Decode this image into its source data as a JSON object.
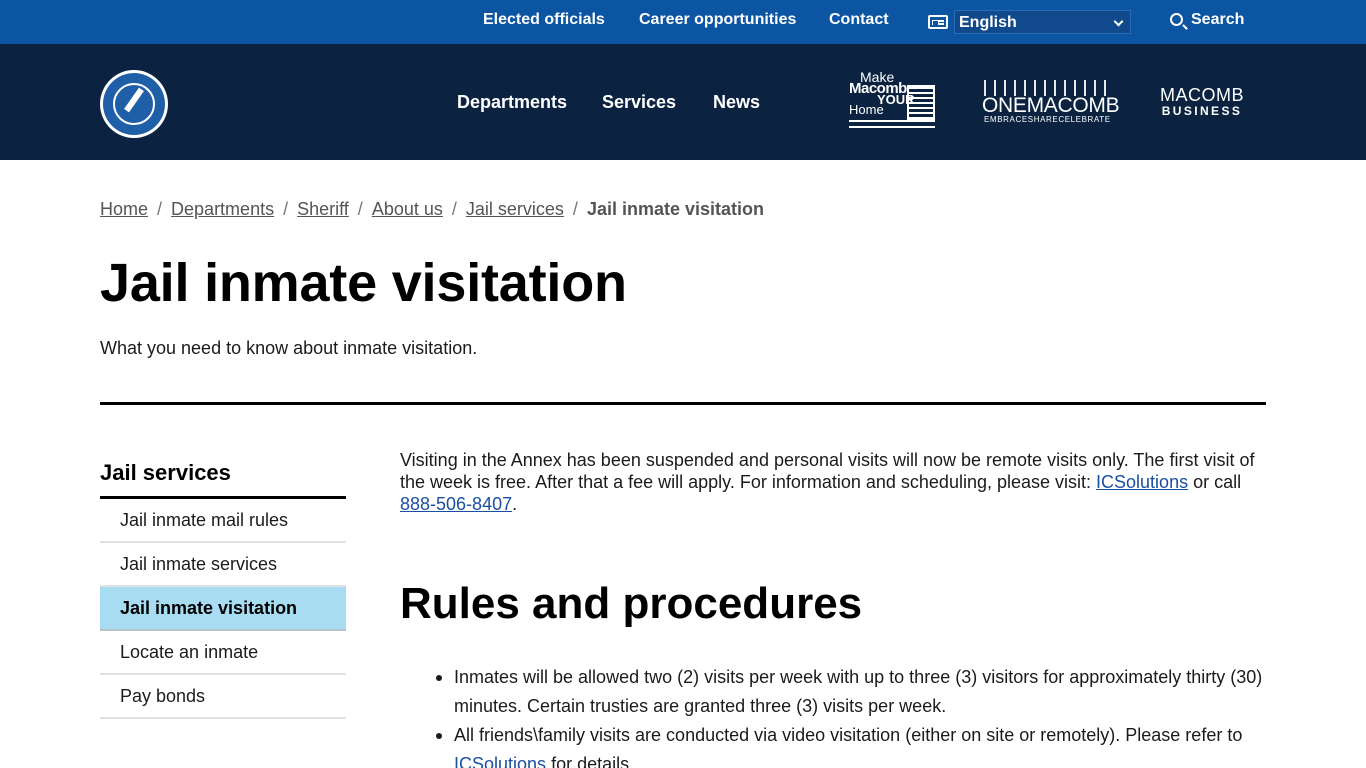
{
  "utility": {
    "links": [
      "Elected officials",
      "Career opportunities",
      "Contact"
    ],
    "language_selected": "English",
    "search_label": "Search"
  },
  "header": {
    "seal_alt": "MACOMB COUNTY MICHIGAN",
    "nav": [
      "Departments",
      "Services",
      "News"
    ],
    "logo_mymh": {
      "line1": "Make",
      "line2": "Macomb",
      "line3": "YOUR",
      "line4": "Home"
    },
    "logo_onemacomb": {
      "name": "ONEMACOMB",
      "tagline": "EMBRACESHARECELEBRATE"
    },
    "logo_business": {
      "line1": "MACOMB",
      "line2": "BUSINESS"
    }
  },
  "breadcrumb": {
    "items": [
      "Home",
      "Departments",
      "Sheriff",
      "About us",
      "Jail services"
    ],
    "separator": "/",
    "current": "Jail inmate visitation"
  },
  "page": {
    "title": "Jail inmate visitation",
    "subtitle": "What you need to know about inmate visitation."
  },
  "sidenav": {
    "heading": "Jail services",
    "items": [
      "Jail inmate mail rules",
      "Jail inmate services",
      "Jail inmate visitation",
      "Locate an inmate",
      "Pay bonds"
    ],
    "active_index": 2
  },
  "content": {
    "intro_text": "Visiting in the Annex has been suspended and personal visits will now be remote visits only. The first visit of the week is free. After that a fee will apply.  For information and scheduling, please visit: ",
    "intro_link": "ICSolutions",
    "intro_middle": " or call ",
    "intro_phone": "888-506-8407",
    "intro_end": ".",
    "section_heading": "Rules and procedures",
    "rule_1": "Inmates will be allowed two (2) visits per week with up to three (3) visitors for approximately thirty (30) minutes. Certain trusties are granted three (3) visits per week.",
    "rule_2_text": "All friends\\family visits are conducted via video visitation (either on site or remotely). Please refer to ",
    "rule_2_link": "ICSolutions",
    "rule_2_end": " for details."
  },
  "colors": {
    "utility_bar": "#0c55a2",
    "header": "#0b2341",
    "active_nav": "#a8dcf2",
    "link": "#1a4fa0"
  }
}
